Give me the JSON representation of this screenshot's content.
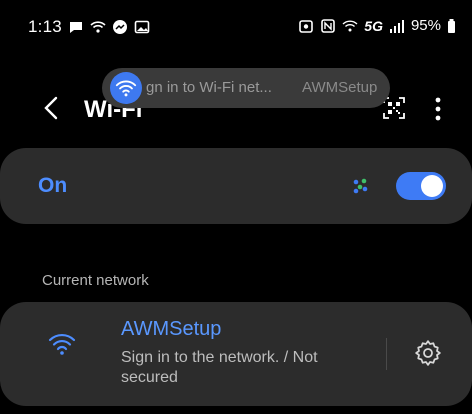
{
  "status_bar": {
    "time": "1:13",
    "network_type": "5G",
    "battery": "95%"
  },
  "toast": {
    "text": "gn in to Wi-Fi net...",
    "ssid": "AWMSetup",
    "icon": "wifi-icon"
  },
  "header": {
    "title": "Wi-Fi"
  },
  "toggle": {
    "label": "On",
    "state": "on"
  },
  "current_network": {
    "section_label": "Current network",
    "name": "AWMSetup",
    "status": "Sign in to the network. / Not secured"
  },
  "colors": {
    "accent": "#3e7bf5",
    "background": "#000000",
    "card": "#2c2c2c",
    "toast": "#3a3a3a"
  }
}
